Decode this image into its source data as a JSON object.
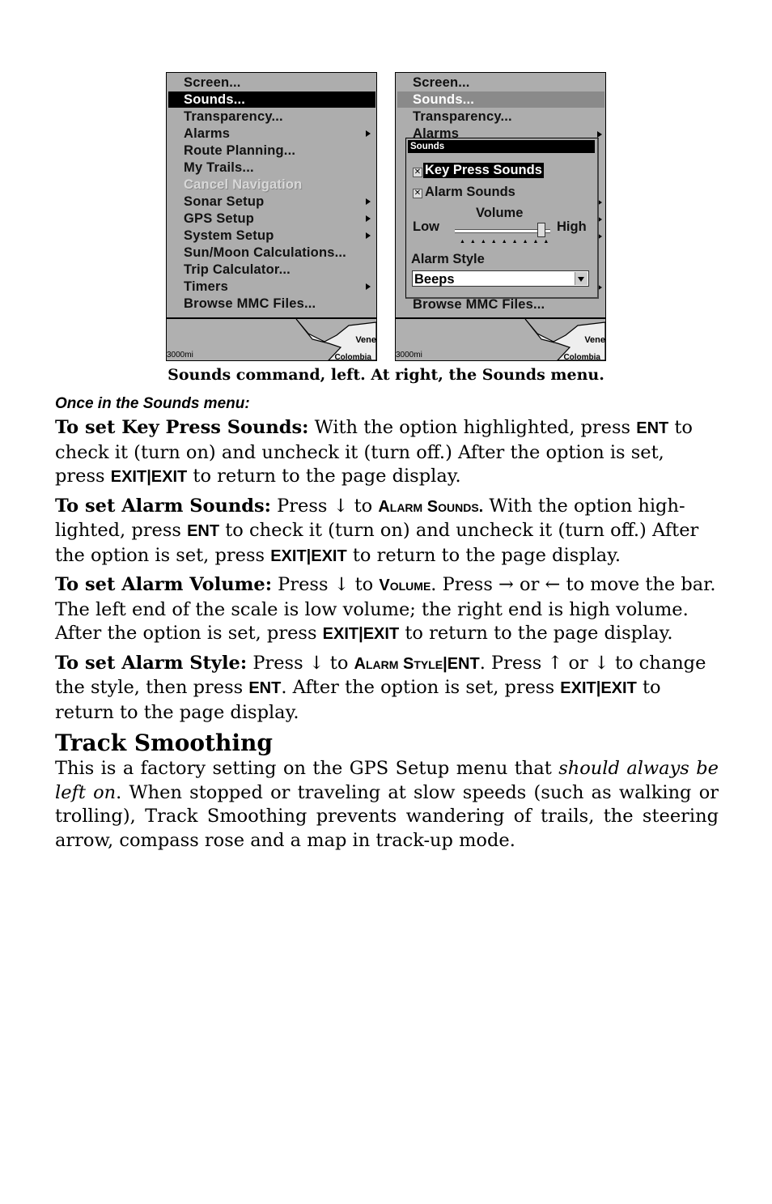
{
  "left_screen": {
    "items": [
      {
        "label": "Screen...",
        "state": "normal",
        "submenu": false
      },
      {
        "label": "Sounds...",
        "state": "selected",
        "submenu": false
      },
      {
        "label": "Transparency...",
        "state": "normal",
        "submenu": false
      },
      {
        "label": "Alarms",
        "state": "normal",
        "submenu": true
      },
      {
        "label": "Route Planning...",
        "state": "normal",
        "submenu": false
      },
      {
        "label": "My Trails...",
        "state": "normal",
        "submenu": false
      },
      {
        "label": "Cancel Navigation",
        "state": "disabled",
        "submenu": false
      },
      {
        "label": "Sonar Setup",
        "state": "normal",
        "submenu": true
      },
      {
        "label": "GPS Setup",
        "state": "normal",
        "submenu": true
      },
      {
        "label": "System Setup",
        "state": "normal",
        "submenu": true
      },
      {
        "label": "Sun/Moon Calculations...",
        "state": "normal",
        "submenu": false
      },
      {
        "label": "Trip Calculator...",
        "state": "normal",
        "submenu": false
      },
      {
        "label": "Timers",
        "state": "normal",
        "submenu": true
      },
      {
        "label": "Browse MMC Files...",
        "state": "normal",
        "submenu": false
      }
    ],
    "map": {
      "scale": "3000mi",
      "label1": "Vene",
      "label2": "Colombia"
    }
  },
  "right_screen": {
    "items_top": [
      "Screen...",
      "Sounds...",
      "Transparency...",
      "Alarms"
    ],
    "item_bottom": "Browse MMC Files...",
    "dialog": {
      "title": "Sounds",
      "key_press": {
        "label": "Key Press Sounds",
        "checked": true
      },
      "alarm_sounds": {
        "label": "Alarm Sounds",
        "checked": true
      },
      "volume_label": "Volume",
      "low": "Low",
      "high": "High",
      "volume_fraction": 0.9,
      "alarm_style_label": "Alarm Style",
      "alarm_style_value": "Beeps"
    },
    "map": {
      "scale": "3000mi",
      "label1": "Vene",
      "label2": "Colombia"
    }
  },
  "caption": "Sounds command, left. At right, the Sounds menu.",
  "subheading": "Once in the Sounds menu:",
  "paragraphs": [
    [
      {
        "s": "b",
        "t": "To set Key Press Sounds:"
      },
      {
        "t": " With the option highlighted, press "
      },
      {
        "s": "k",
        "t": "ENT"
      },
      {
        "t": " to check it (turn on) and uncheck it (turn off.) After the option is set, press "
      },
      {
        "s": "k",
        "t": "EXIT|EXIT"
      },
      {
        "t": " to return to the page display."
      }
    ],
    [
      {
        "s": "b",
        "t": "To set Alarm Sounds:"
      },
      {
        "t": " Press ↓ to "
      },
      {
        "s": "sc",
        "t": "Alarm Sounds."
      },
      {
        "t": " With the option high-lighted, press "
      },
      {
        "s": "k",
        "t": "ENT"
      },
      {
        "t": " to check it (turn on) and uncheck it (turn off.) After the option is set, press "
      },
      {
        "s": "k",
        "t": "EXIT|EXIT"
      },
      {
        "t": " to return to the page display."
      }
    ],
    [
      {
        "s": "b",
        "t": "To set Alarm Volume:"
      },
      {
        "t": " Press ↓ to "
      },
      {
        "s": "sc",
        "t": "Volume"
      },
      {
        "t": ". Press → or ←  to move the bar. The left end of the scale is low volume; the right end is high volume. After the option is set, press "
      },
      {
        "s": "k",
        "t": "EXIT|EXIT"
      },
      {
        "t": " to return to the page display."
      }
    ],
    [
      {
        "s": "b",
        "t": "To set Alarm Style:"
      },
      {
        "t": " Press ↓ to "
      },
      {
        "s": "sc",
        "t": "Alarm Style"
      },
      {
        "s": "k",
        "t": "|ENT"
      },
      {
        "t": ". Press ↑ or ↓ to change the style, then press "
      },
      {
        "s": "k",
        "t": "ENT"
      },
      {
        "t": ". After the option is set, press "
      },
      {
        "s": "k",
        "t": "EXIT|EXIT"
      },
      {
        "t": " to return to the page display."
      }
    ]
  ],
  "section_title": "Track Smoothing",
  "section_paragraph": [
    {
      "t": "This is a factory setting on the GPS Setup menu that "
    },
    {
      "s": "i",
      "t": "should always be left on"
    },
    {
      "t": ". When stopped or traveling at slow speeds (such as walking or trolling), Track Smoothing prevents wandering of trails, the steering arrow, compass rose and a map in track-up mode."
    }
  ]
}
